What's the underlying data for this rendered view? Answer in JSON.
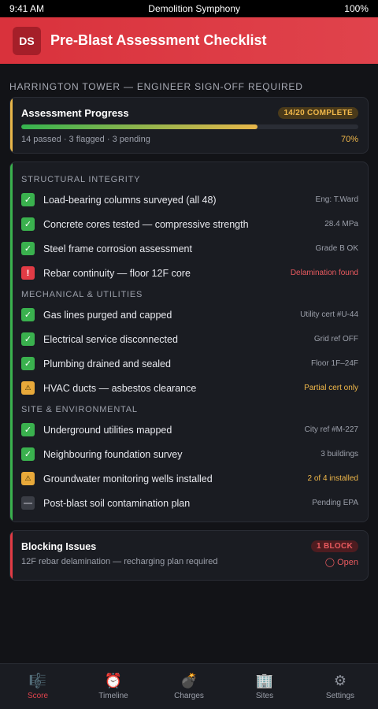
{
  "status": {
    "time": "9:41 AM",
    "carrier": "Demolition Symphony",
    "battery": "100%"
  },
  "app": {
    "badge": "DS",
    "title": "Pre-Blast Assessment Checklist"
  },
  "subtitle": "HARRINGTON TOWER — ENGINEER SIGN-OFF REQUIRED",
  "progress": {
    "title": "Assessment Progress",
    "badge": "14/20 COMPLETE",
    "summary": "14 passed · 3 flagged · 3 pending",
    "percent_label": "70%",
    "fraction": 0.7,
    "accent_color": "#e8b64a"
  },
  "checklist": {
    "accent_color": "#3ab14e",
    "groups": [
      {
        "title": "STRUCTURAL INTEGRITY",
        "items": [
          {
            "label": "Load-bearing columns surveyed (all 48)",
            "meta": "Eng: T.Ward",
            "status": "ok",
            "glyph": "✓"
          },
          {
            "label": "Concrete cores tested — compressive strength",
            "meta": "28.4 MPa",
            "status": "ok",
            "glyph": "✓"
          },
          {
            "label": "Steel frame corrosion assessment",
            "meta": "Grade B OK",
            "status": "ok",
            "glyph": "✓"
          },
          {
            "label": "Rebar continuity — floor 12F core",
            "meta": "Delamination found",
            "status": "fail",
            "glyph": "!"
          }
        ]
      },
      {
        "title": "MECHANICAL & UTILITIES",
        "items": [
          {
            "label": "Gas lines purged and capped",
            "meta": "Utility cert #U-44",
            "status": "ok",
            "glyph": "✓"
          },
          {
            "label": "Electrical service disconnected",
            "meta": "Grid ref OFF",
            "status": "ok",
            "glyph": "✓"
          },
          {
            "label": "Plumbing drained and sealed",
            "meta": "Floor 1F–24F",
            "status": "ok",
            "glyph": "✓"
          },
          {
            "label": "HVAC ducts — asbestos clearance",
            "meta": "Partial cert only",
            "status": "warn",
            "glyph": "⚠"
          }
        ]
      },
      {
        "title": "SITE & ENVIRONMENTAL",
        "items": [
          {
            "label": "Underground utilities mapped",
            "meta": "City ref #M-227",
            "status": "ok",
            "glyph": "✓"
          },
          {
            "label": "Neighbouring foundation survey",
            "meta": "3 buildings",
            "status": "ok",
            "glyph": "✓"
          },
          {
            "label": "Groundwater monitoring wells installed",
            "meta": "2 of 4 installed",
            "status": "warn",
            "glyph": "⚠"
          },
          {
            "label": "Post-blast soil contamination plan",
            "meta": "Pending EPA",
            "status": "pend",
            "glyph": "—"
          }
        ]
      }
    ]
  },
  "blocking": {
    "title": "Blocking Issues",
    "badge": "1 BLOCK",
    "description": "12F rebar delamination — recharging plan required",
    "state": "◯ Open",
    "accent_color": "#e13b45"
  },
  "tabs": [
    {
      "label": "Score",
      "icon": "🎼",
      "icon_name": "score-icon",
      "active": true
    },
    {
      "label": "Timeline",
      "icon": "⏰",
      "icon_name": "timeline-icon",
      "active": false
    },
    {
      "label": "Charges",
      "icon": "💣",
      "icon_name": "charges-icon",
      "active": false
    },
    {
      "label": "Sites",
      "icon": "🏢",
      "icon_name": "sites-icon",
      "active": false
    },
    {
      "label": "Settings",
      "icon": "⚙",
      "icon_name": "settings-icon",
      "active": false
    }
  ]
}
